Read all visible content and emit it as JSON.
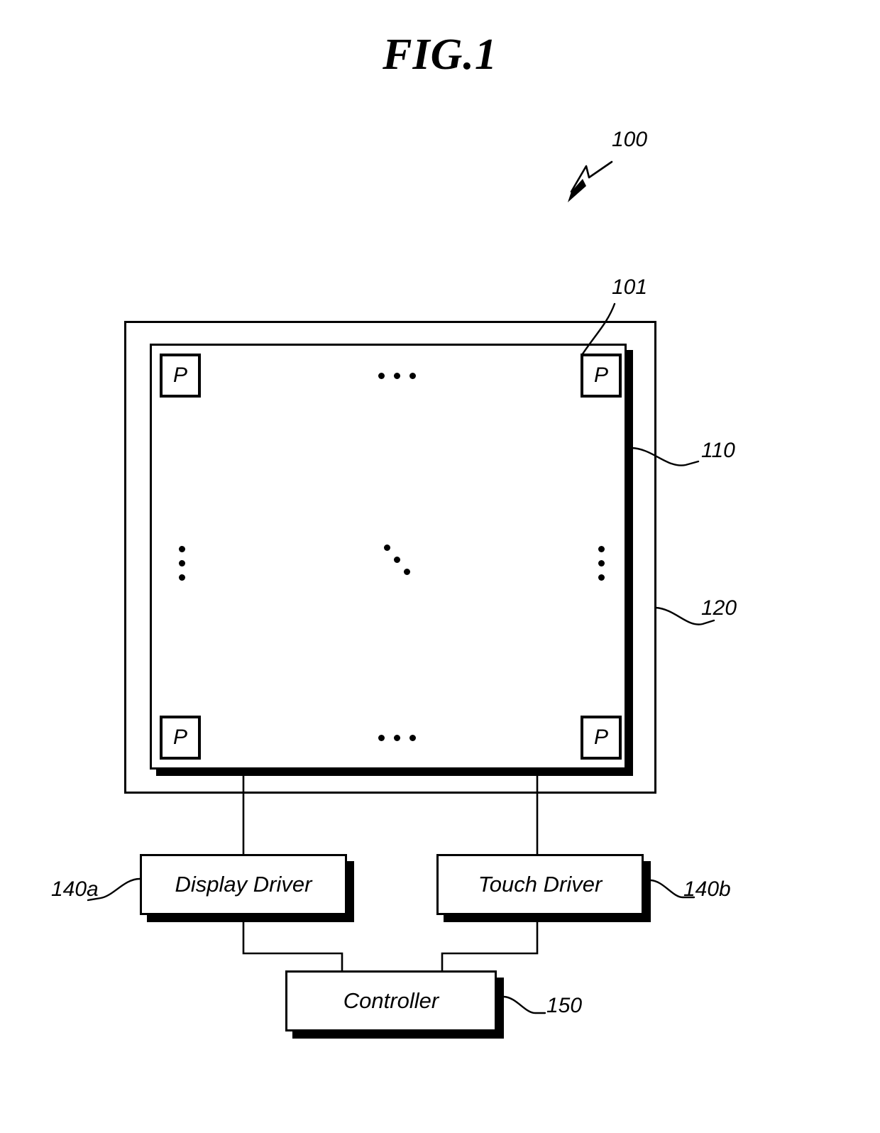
{
  "figure": {
    "title": "FIG.1",
    "assembly_label": "100"
  },
  "panel": {
    "outer_frame_label": "120",
    "inner_panel_label": "110",
    "pixel_corner_label": "101",
    "cells": [
      {
        "label": "P",
        "position": "top-left"
      },
      {
        "label": "P",
        "position": "top-right"
      },
      {
        "label": "P",
        "position": "bottom-left"
      },
      {
        "label": "P",
        "position": "bottom-right"
      }
    ],
    "ellipses": [
      {
        "name": "top-horizontal-ellipsis",
        "orientation": "horizontal"
      },
      {
        "name": "bottom-horizontal-ellipsis",
        "orientation": "horizontal"
      },
      {
        "name": "left-vertical-ellipsis",
        "orientation": "vertical"
      },
      {
        "name": "right-vertical-ellipsis",
        "orientation": "vertical"
      },
      {
        "name": "center-diagonal-ellipsis",
        "orientation": "diagonal"
      }
    ]
  },
  "blocks": {
    "display_driver": {
      "label": "Display Driver",
      "ref": "140a"
    },
    "touch_driver": {
      "label": "Touch Driver",
      "ref": "140b"
    },
    "controller": {
      "label": "Controller",
      "ref": "150"
    }
  },
  "colors": {
    "line": "#000000",
    "background": "#ffffff"
  }
}
